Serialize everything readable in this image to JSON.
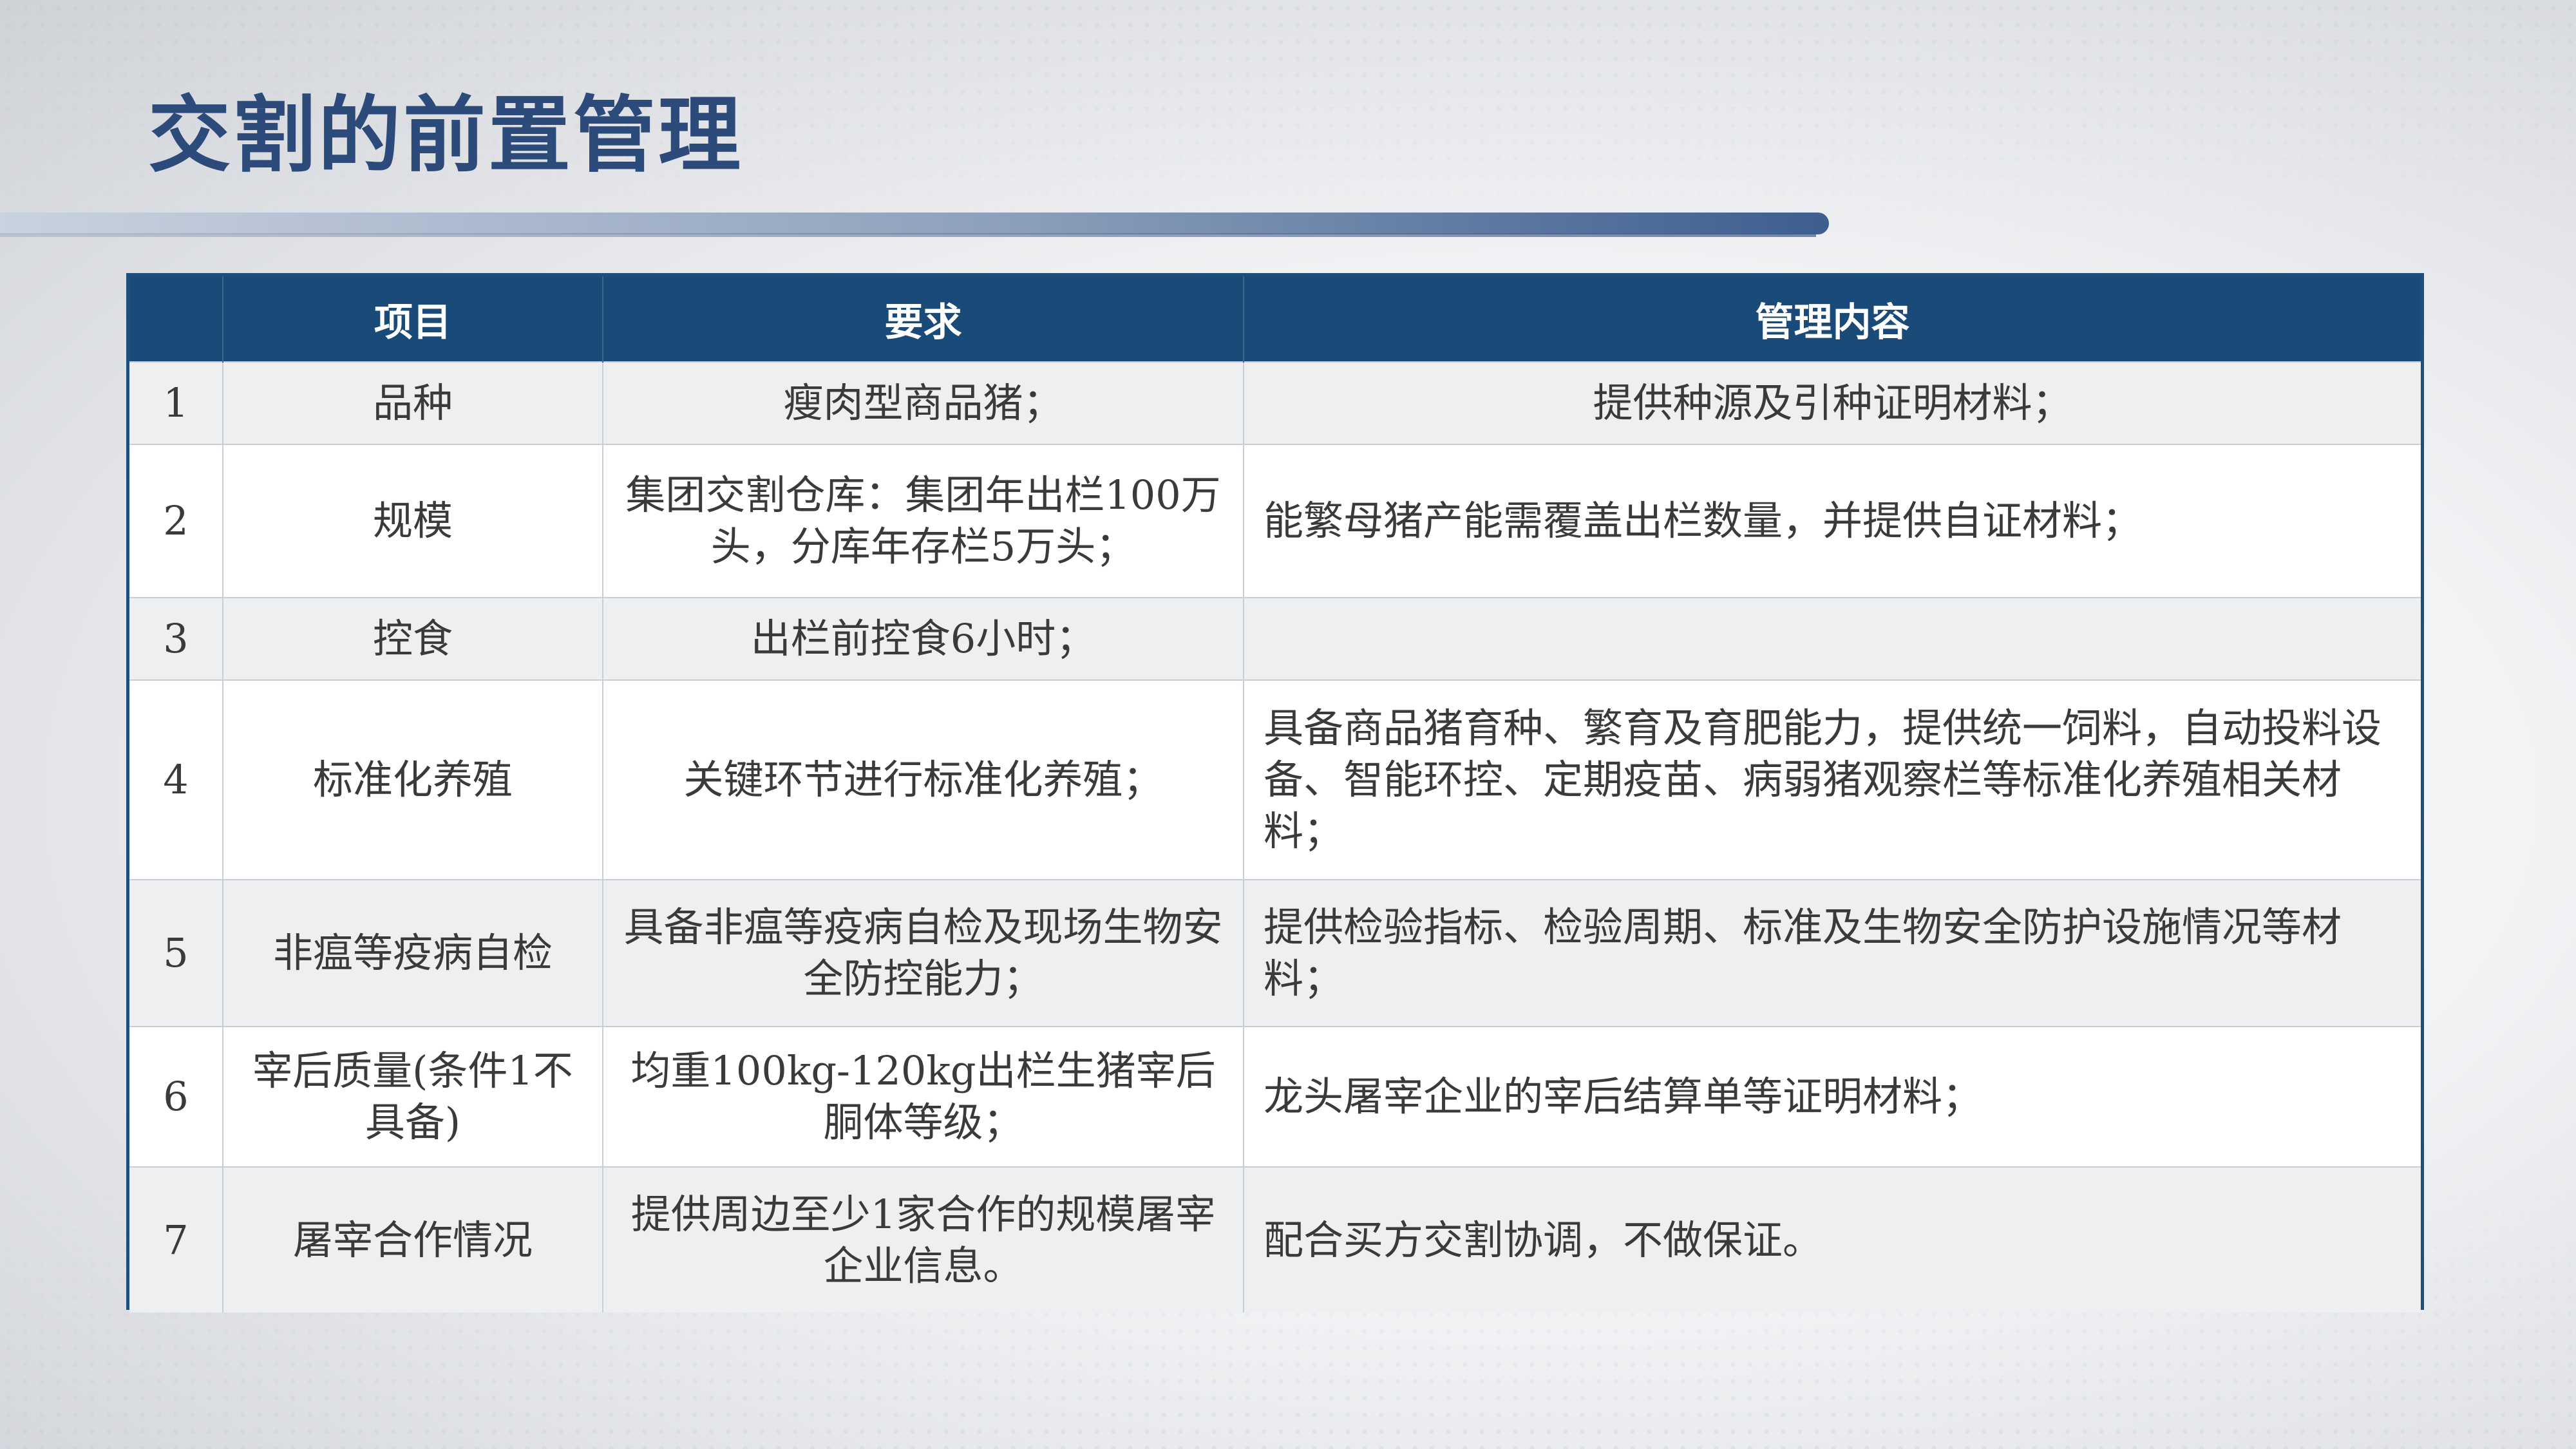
{
  "title": "交割的前置管理",
  "table": {
    "headers": [
      "",
      "项目",
      "要求",
      "管理内容"
    ],
    "rows": [
      {
        "no": "1",
        "item": "品种",
        "requirement": "瘦肉型商品猪；",
        "content": "提供种源及引种证明材料；"
      },
      {
        "no": "2",
        "item": "规模",
        "requirement": "集团交割仓库：集团年出栏100万头，分库年存栏5万头；",
        "content": "能繁母猪产能需覆盖出栏数量，并提供自证材料；"
      },
      {
        "no": "3",
        "item": "控食",
        "requirement": "出栏前控食6小时；",
        "content": ""
      },
      {
        "no": "4",
        "item": "标准化养殖",
        "requirement": "关键环节进行标准化养殖；",
        "content": "具备商品猪育种、繁育及育肥能力，提供统一饲料，自动投料设备、智能环控、定期疫苗、病弱猪观察栏等标准化养殖相关材料；"
      },
      {
        "no": "5",
        "item": "非瘟等疫病自检",
        "requirement": "具备非瘟等疫病自检及现场生物安全防控能力；",
        "content": "提供检验指标、检验周期、标准及生物安全防护设施情况等材料；"
      },
      {
        "no": "6",
        "item": "宰后质量(条件1不具备)",
        "requirement": "均重100kg-120kg出栏生猪宰后胴体等级；",
        "content": "龙头屠宰企业的宰后结算单等证明材料；"
      },
      {
        "no": "7",
        "item": "屠宰合作情况",
        "requirement": "提供周边至少1家合作的规模屠宰企业信息。",
        "content": "配合买方交割协调，不做保证。"
      }
    ]
  },
  "colors": {
    "title": "#2c4a7a",
    "header_bg": "#1a4a77",
    "header_text": "#ffffff",
    "row_alt": "#eeeff1"
  }
}
